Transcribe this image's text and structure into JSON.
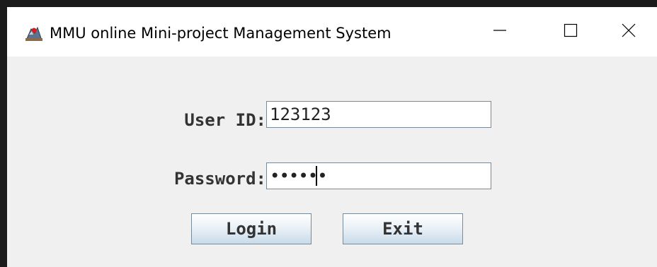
{
  "window": {
    "title": "MMU online Mini-project Management System",
    "controls": {
      "minimize_icon": "minimize-icon",
      "maximize_icon": "maximize-icon",
      "close_icon": "close-icon"
    }
  },
  "form": {
    "user_id_label": "User ID:",
    "user_id_value": "123123",
    "password_label": "Password:",
    "password_value": "123123",
    "login_label": "Login",
    "exit_label": "Exit"
  },
  "colors": {
    "window_bg": "#f0f0f0",
    "titlebar_bg": "#ffffff",
    "label_text": "#333333",
    "button_gradient_bottom": "#c9dbea",
    "field_border": "#7a8a99"
  }
}
